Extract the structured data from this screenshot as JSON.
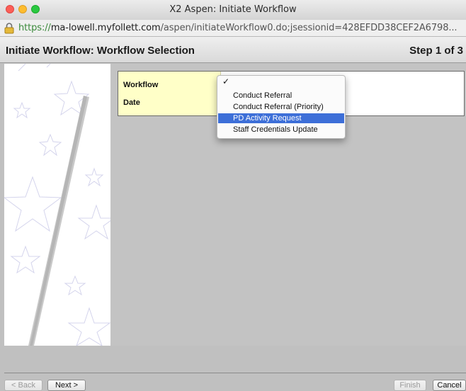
{
  "window": {
    "title": "X2 Aspen: Initiate Workflow"
  },
  "urlbar": {
    "scheme": "https://",
    "host": "ma-lowell.myfollett.com",
    "path": "/aspen/initiateWorkflow0.do;jsessionid=428EFDD38CEF2A6798..."
  },
  "header": {
    "title": "Initiate Workflow: Workflow Selection",
    "step": "Step 1 of 3"
  },
  "form": {
    "workflow_label": "Workflow",
    "date_label": "Date"
  },
  "workflow_menu": {
    "check_mark": "✓",
    "items": [
      {
        "label": "Conduct Referral"
      },
      {
        "label": "Conduct Referral (Priority)"
      },
      {
        "label": "PD Activity Request"
      },
      {
        "label": "Staff Credentials Update"
      }
    ],
    "highlighted": "PD Activity Request"
  },
  "footer": {
    "back": "< Back",
    "next": "Next >",
    "finish": "Finish",
    "cancel": "Cancel"
  },
  "icons": {
    "lock": "lock-icon",
    "decoration": "magic-wand-stars"
  },
  "colors": {
    "label_bg": "#ffffc8",
    "menu_highlight": "#3d6fd8",
    "url_scheme": "#3b8a3b"
  }
}
